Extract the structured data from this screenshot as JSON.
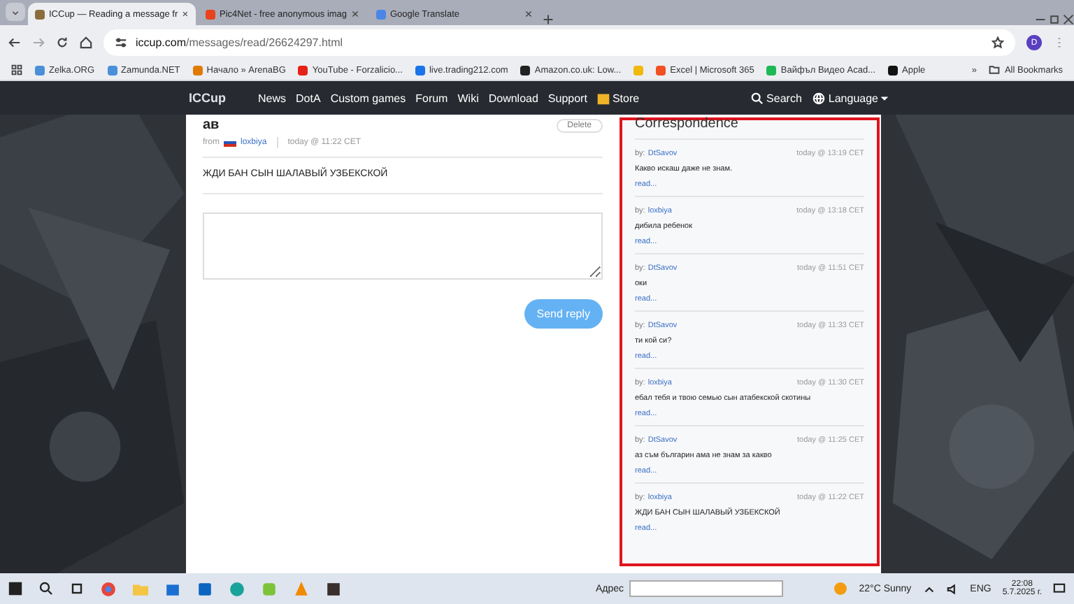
{
  "browser": {
    "tabs": [
      {
        "title": "ICCup — Reading a message fr",
        "selected": true,
        "color": "#8a6d3b"
      },
      {
        "title": "Pic4Net - free anonymous imag",
        "selected": false,
        "color": "#e8431c"
      },
      {
        "title": "Google Translate",
        "selected": false,
        "color": "#4a86e8"
      }
    ],
    "url_host": "iccup.com",
    "url_path": "/messages/read/26624297.html",
    "profile": "D",
    "bookmarks": [
      {
        "label": "Zelka.ORG",
        "color": "#4a90d9"
      },
      {
        "label": "Zamunda.NET",
        "color": "#4a90d9"
      },
      {
        "label": "Начало » ArenaBG",
        "color": "#e07b00"
      },
      {
        "label": "YouTube - Forzalicio...",
        "color": "#e62117"
      },
      {
        "label": "live.trading212.com",
        "color": "#1a73e8"
      },
      {
        "label": "Amazon.co.uk: Low...",
        "color": "#222222"
      },
      {
        "color": "#f0b90b"
      },
      {
        "label": "Excel | Microsoft 365",
        "color": "#f25022"
      },
      {
        "label": "Вайфъл Видео Acad...",
        "color": "#1db954"
      },
      {
        "label": "Apple",
        "color": "#111111"
      }
    ],
    "more": "»",
    "all_bookmarks": "All Bookmarks"
  },
  "site": {
    "logo": "ICCup",
    "nav": [
      "News",
      "DotA",
      "Custom games",
      "Forum",
      "Wiki",
      "Download",
      "Support"
    ],
    "store": "Store",
    "search": "Search",
    "language": "Language"
  },
  "message": {
    "title": "ав",
    "from_label": "from",
    "author": "loxbiya",
    "time": "today @ 11:22 CET",
    "delete": "Delete",
    "body": "ЖДИ БАН СЫН ШАЛАВЫЙ УЗБЕКСКОЙ",
    "send": "Send reply"
  },
  "correspondence": {
    "title": "Correspondence",
    "items": [
      {
        "by": "by:",
        "author": "DtSavov",
        "time": "today @ 13:19 CET",
        "text": "Какво искаш даже не знам.",
        "link": "read..."
      },
      {
        "by": "by:",
        "author": "loxbiya",
        "time": "today @ 13:18 CET",
        "text": "дибила ребенок",
        "link": "read..."
      },
      {
        "by": "by:",
        "author": "DtSavov",
        "time": "today @ 11:51 CET",
        "text": "оки",
        "link": "read..."
      },
      {
        "by": "by:",
        "author": "DtSavov",
        "time": "today @ 11:33 CET",
        "text": "ти кой си?",
        "link": "read..."
      },
      {
        "by": "by:",
        "author": "loxbiya",
        "time": "today @ 11:30 CET",
        "text": "ебал тебя и твою семью сын атабекской скотины",
        "link": "read..."
      },
      {
        "by": "by:",
        "author": "DtSavov",
        "time": "today @ 11:25 CET",
        "text": "аз съм българин ама не знам за какво",
        "link": "read..."
      },
      {
        "by": "by:",
        "author": "loxbiya",
        "time": "today @ 11:22 CET",
        "text": "ЖДИ БАН СЫН ШАЛАВЫЙ УЗБЕКСКОЙ",
        "link": "read..."
      }
    ]
  },
  "taskbar": {
    "address_label": "Адрес",
    "weather": "22°C  Sunny",
    "lang": "ENG",
    "time": "22:08",
    "date": "5.7.2025 г."
  }
}
